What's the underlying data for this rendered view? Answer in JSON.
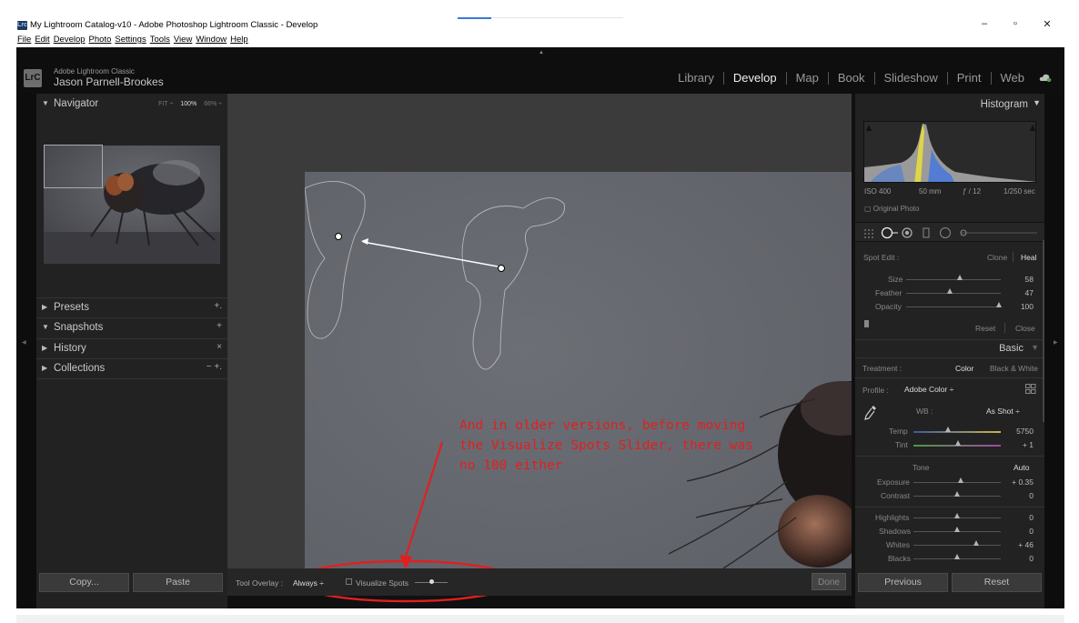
{
  "window": {
    "title": "My Lightroom Catalog-v10 - Adobe Photoshop Lightroom Classic - Develop",
    "icon_label": "Lrc",
    "controls": [
      "–",
      "▫",
      "✕"
    ]
  },
  "menu": [
    "File",
    "Edit",
    "Develop",
    "Photo",
    "Settings",
    "Tools",
    "View",
    "Window",
    "Help"
  ],
  "identity": {
    "logo": "LrC",
    "app_name": "Adobe Lightroom Classic",
    "user": "Jason Parnell-Brookes"
  },
  "modules": [
    {
      "label": "Library",
      "active": false
    },
    {
      "label": "Develop",
      "active": true
    },
    {
      "label": "Map",
      "active": false
    },
    {
      "label": "Book",
      "active": false
    },
    {
      "label": "Slideshow",
      "active": false
    },
    {
      "label": "Print",
      "active": false
    },
    {
      "label": "Web",
      "active": false
    }
  ],
  "left_panel": {
    "navigator": {
      "label": "Navigator",
      "zoom": [
        "FIT ÷",
        "100%",
        "66% ÷"
      ],
      "active_zoom": "100%"
    },
    "sections": [
      {
        "label": "Presets",
        "action": "+."
      },
      {
        "label": "Snapshots",
        "action": "+"
      },
      {
        "label": "History",
        "action": "×"
      },
      {
        "label": "Collections",
        "action": "− +."
      }
    ],
    "copy_button": "Copy...",
    "paste_button": "Paste"
  },
  "toolbar": {
    "overlay_label": "Tool Overlay :",
    "overlay_value": "Always ÷",
    "visualize_label": "Visualize Spots",
    "visualize_checked": false,
    "done_button": "Done"
  },
  "right_panel": {
    "histogram_label": "Histogram",
    "exif": {
      "iso": "ISO 400",
      "focal": "50 mm",
      "aperture": "ƒ / 12",
      "shutter": "1/250 sec"
    },
    "original_photo_label": "Original Photo",
    "spot_edit": {
      "label": "Spot Edit :",
      "modes": [
        "Clone",
        "Heal"
      ],
      "active_mode": "Heal",
      "sliders": [
        {
          "label": "Size",
          "value": "58",
          "level": 0.58
        },
        {
          "label": "Feather",
          "value": "47",
          "level": 0.47
        },
        {
          "label": "Opacity",
          "value": "100",
          "level": 1.0
        }
      ],
      "reset_button": "Reset",
      "close_button": "Close"
    },
    "basic": {
      "label": "Basic",
      "treatment_label": "Treatment :",
      "treatment_options": [
        "Color",
        "Black & White"
      ],
      "active_treatment": "Color",
      "profile_label": "Profile :",
      "profile_value": "Adobe Color ÷",
      "wb_label": "WB :",
      "wb_value": "As Shot ÷",
      "temp": {
        "label": "Temp",
        "value": "5750",
        "level": 0.4
      },
      "tint": {
        "label": "Tint",
        "value": "+ 1",
        "level": 0.51
      },
      "tone_label": "Tone",
      "auto_label": "Auto",
      "tone_sliders": [
        {
          "label": "Exposure",
          "value": "+ 0.35",
          "level": 0.54
        },
        {
          "label": "Contrast",
          "value": "0",
          "level": 0.5
        },
        {
          "label": "Highlights",
          "value": "0",
          "level": 0.5
        },
        {
          "label": "Shadows",
          "value": "0",
          "level": 0.5
        },
        {
          "label": "Whites",
          "value": "+ 46",
          "level": 0.72
        },
        {
          "label": "Blacks",
          "value": "0",
          "level": 0.5
        }
      ]
    },
    "previous_button": "Previous",
    "reset_button": "Reset"
  },
  "annotation": {
    "text": "And in older versions, before moving\nthe Visualize Spots Slider, there was\nno 100 either",
    "color": "#e02020"
  }
}
